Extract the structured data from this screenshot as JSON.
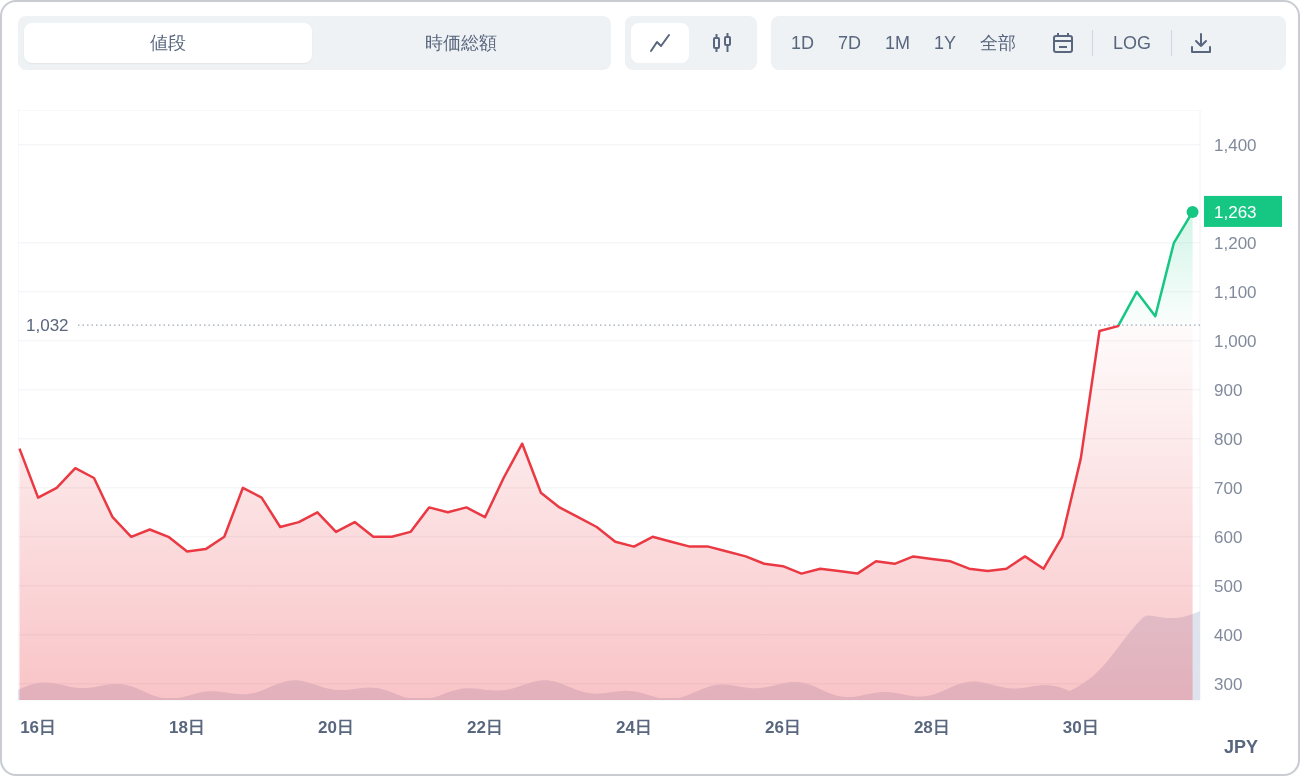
{
  "price_tabs": [
    {
      "label": "値段",
      "selected": true
    },
    {
      "label": "時価総額",
      "selected": false
    }
  ],
  "chart_types": [
    {
      "kind": "line",
      "selected": true
    },
    {
      "kind": "candle",
      "selected": false
    }
  ],
  "ranges": [
    {
      "label": "1D"
    },
    {
      "label": "7D"
    },
    {
      "label": "1M"
    },
    {
      "label": "1Y"
    },
    {
      "label": "全部"
    }
  ],
  "log_button": "LOG",
  "chart": {
    "currency": "JPY",
    "current_price": "1,263",
    "chart_data": {
      "type": "area",
      "grid": true,
      "xlim": [
        15.73,
        31.6
      ],
      "ylim": [
        267,
        1471
      ],
      "x": [
        15.75,
        16,
        16.25,
        16.5,
        16.75,
        17,
        17.25,
        17.5,
        17.75,
        18,
        18.25,
        18.5,
        18.75,
        19,
        19.25,
        19.5,
        19.75,
        20,
        20.25,
        20.5,
        20.75,
        21,
        21.25,
        21.5,
        21.75,
        22,
        22.25,
        22.5,
        22.75,
        23,
        23.25,
        23.5,
        23.75,
        24,
        24.25,
        24.5,
        24.75,
        25,
        25.25,
        25.5,
        25.75,
        26,
        26.25,
        26.5,
        26.75,
        27,
        27.25,
        27.5,
        27.75,
        28,
        28.25,
        28.5,
        28.75,
        29,
        29.25,
        29.5,
        29.75,
        30,
        30.25,
        30.5,
        30.75,
        31,
        31.25,
        31.5
      ],
      "series": [
        {
          "color": "#ea3943",
          "values": [
            780,
            680,
            700,
            740,
            720,
            640,
            600,
            615,
            600,
            570,
            575,
            600,
            700,
            680,
            620,
            630,
            650,
            610,
            630,
            600,
            600,
            610,
            660,
            650,
            660,
            640,
            720,
            790,
            690,
            660,
            640,
            620,
            590,
            580,
            600,
            590,
            580,
            580,
            570,
            560,
            545,
            540,
            525,
            535,
            530,
            525,
            550,
            545,
            560,
            555,
            550,
            535,
            530,
            535,
            560,
            535,
            600,
            760,
            1020,
            1030,
            1100,
            1050,
            1200,
            1263
          ]
        }
      ],
      "xticks": [
        {
          "value": 16,
          "label": "16日"
        },
        {
          "value": 18,
          "label": "18日"
        },
        {
          "value": 20,
          "label": "20日"
        },
        {
          "value": 22,
          "label": "22日"
        },
        {
          "value": 24,
          "label": "24日"
        },
        {
          "value": 26,
          "label": "26日"
        },
        {
          "value": 28,
          "label": "28日"
        },
        {
          "value": 30,
          "label": "30日"
        }
      ],
      "yticks": [
        {
          "value": 1400,
          "label": "1,400"
        },
        {
          "value": 1200,
          "label": "1,200"
        },
        {
          "value": 1100,
          "label": "1,100"
        },
        {
          "value": 1000,
          "label": "1,000"
        },
        {
          "value": 900,
          "label": "900"
        },
        {
          "value": 800,
          "label": "800"
        },
        {
          "value": 700,
          "label": "700"
        },
        {
          "value": 600,
          "label": "600"
        },
        {
          "value": 500,
          "label": "500"
        },
        {
          "value": 400,
          "label": "400"
        },
        {
          "value": 300,
          "label": "300"
        }
      ],
      "ref_lines": [
        {
          "axis": "y",
          "value": 1032,
          "label": "1,032"
        }
      ]
    }
  }
}
